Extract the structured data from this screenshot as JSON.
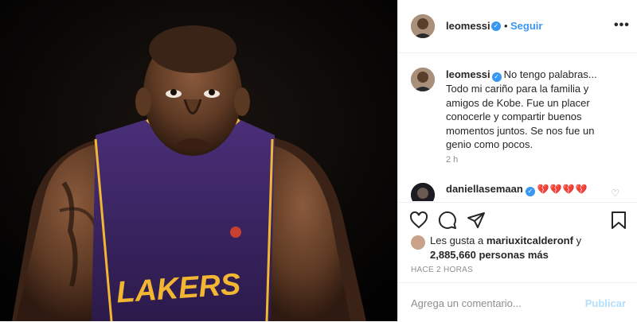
{
  "post": {
    "photo_alt": "kobe-photo",
    "jersey_text": "LAKERS"
  },
  "header": {
    "username": "leomessi",
    "verified_glyph": "✓",
    "separator": "•",
    "follow_label": "Seguir",
    "more_icon": "more-icon",
    "more_glyph": "•••"
  },
  "caption": {
    "username": "leomessi",
    "lines": [
      "No tengo palabras...",
      "Todo mi cariño para la familia y",
      "amigos de Kobe. Fue un placer",
      "conocerle y compartir buenos",
      "momentos juntos. Se nos fue un",
      "genio como pocos."
    ],
    "time": "2 h"
  },
  "comment": {
    "username": "daniellasemaan",
    "text": "💔💔💔💔"
  },
  "actions": {
    "like": "heart-icon",
    "comment": "comment-icon",
    "share": "share-icon",
    "save": "bookmark-icon"
  },
  "likes": {
    "line1_prefix": "Les gusta a",
    "liker": "mariuxitcalderonf",
    "line1_suffix": "y",
    "line2": "2,885,660 personas más"
  },
  "timestamp": "HACE 2 HORAS",
  "add_comment": {
    "placeholder": "Agrega un comentario...",
    "publish_label": "Publicar"
  },
  "colors": {
    "accent": "#3897f0",
    "publish_disabled": "#b2dffc",
    "text": "#262626",
    "muted": "#8e8e8e",
    "heart": "#d9232e"
  }
}
